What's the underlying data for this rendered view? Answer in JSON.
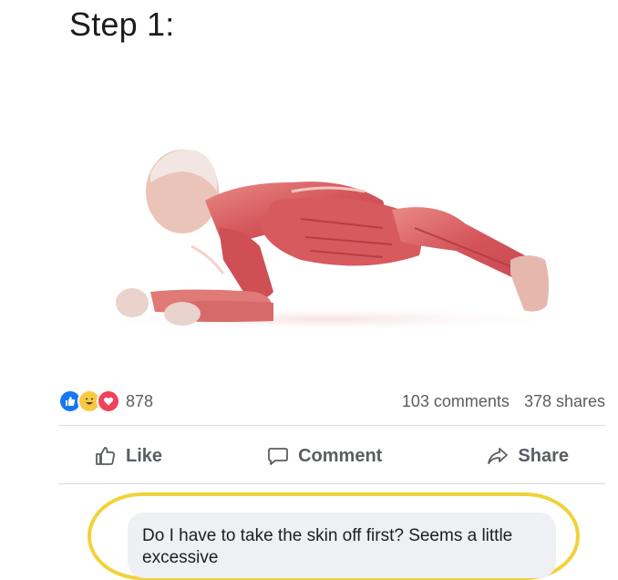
{
  "post": {
    "title": "Step 1:"
  },
  "stats": {
    "reaction_count": "878",
    "comments": "103 comments",
    "shares": "378 shares",
    "reaction_icons": [
      "like-icon",
      "haha-icon",
      "love-icon"
    ]
  },
  "actions": {
    "like_label": "Like",
    "comment_label": "Comment",
    "share_label": "Share"
  },
  "comment": {
    "text": "Do I have to take the skin off first? Seems a little excessive"
  },
  "colors": {
    "like_blue": "#1877f2",
    "haha_yellow": "#f7c843",
    "love_red": "#f0435a",
    "highlight_yellow": "#f0d23a",
    "muscle_red": "#d9555a"
  }
}
